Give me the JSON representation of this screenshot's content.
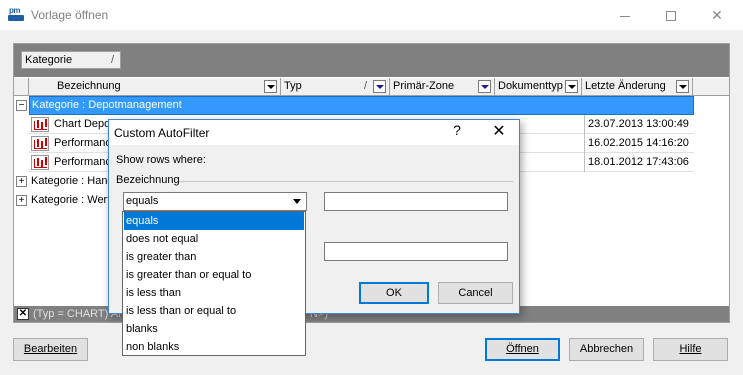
{
  "window": {
    "title": "Vorlage öffnen",
    "app_icon_text": "pm"
  },
  "grid": {
    "group_chip": "Kategorie",
    "group_chip_sort": "/",
    "columns": [
      {
        "label": "Bezeichnung"
      },
      {
        "label": "Typ",
        "sort": "/"
      },
      {
        "label": "Primär-Zone"
      },
      {
        "label": "Dokumenttyp"
      },
      {
        "label": "Letzte Änderung"
      }
    ],
    "groups": [
      {
        "expander": "−",
        "label": "Kategorie : Depotmanagement"
      },
      {
        "expander": "+",
        "label": "Kategorie : Hand"
      },
      {
        "expander": "+",
        "label": "Kategorie : Wert"
      }
    ],
    "rows": [
      {
        "name": "Chart Depo",
        "date": "23.07.2013 13:00:49"
      },
      {
        "name": "Performanc",
        "date": "16.02.2015 14:16:20"
      },
      {
        "name": "Performanc",
        "date": "18.01.2012 17:43:06"
      }
    ],
    "filter_text": "(Typ = CHART) AN",
    "filter_text_tail": "N>)"
  },
  "buttons": {
    "edit": "Bearbeiten",
    "open": "Öffnen",
    "cancel": "Abbrechen",
    "help": "Hilfe"
  },
  "dialog": {
    "title": "Custom AutoFilter",
    "help": "?",
    "close": "✕",
    "show_rows": "Show rows where:",
    "field": "Bezeichnung",
    "operator1": "equals",
    "value1": "",
    "value2": "",
    "ok": "OK",
    "cancel": "Cancel",
    "operators": [
      "equals",
      "does not equal",
      "is greater than",
      "is greater than or equal to",
      "is less than",
      "is less than or equal to",
      "blanks",
      "non blanks"
    ],
    "selected_operator_index": 0
  }
}
